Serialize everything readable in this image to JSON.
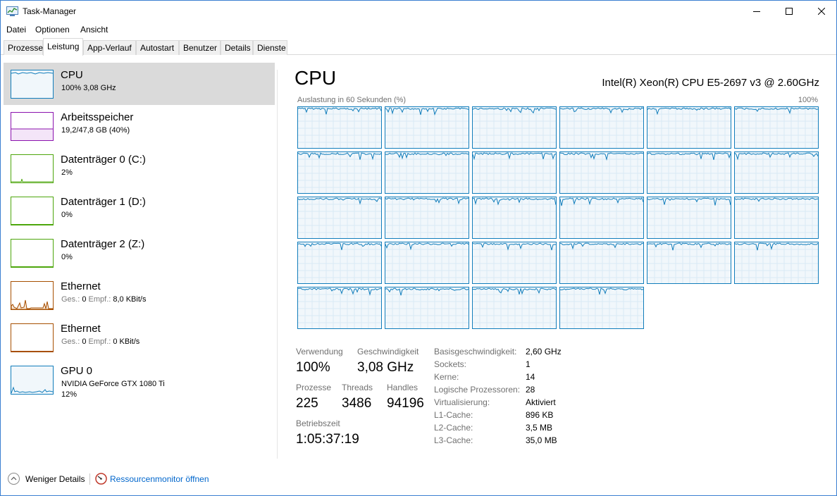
{
  "window": {
    "title": "Task-Manager"
  },
  "menu": [
    "Datei",
    "Optionen",
    "Ansicht"
  ],
  "tabs": [
    "Prozesse",
    "Leistung",
    "App-Verlauf",
    "Autostart",
    "Benutzer",
    "Details",
    "Dienste"
  ],
  "active_tab": "Leistung",
  "sidebar": {
    "items": [
      {
        "title": "CPU",
        "sub1": "100%  3,08 GHz",
        "sub2": "",
        "color": "#117dbb",
        "icon": "cpu-graph-icon"
      },
      {
        "title": "Arbeitsspeicher",
        "sub1": "19,2/47,8 GB (40%)",
        "sub2": "",
        "color": "#8b12ae",
        "icon": "memory-graph-icon"
      },
      {
        "title": "Datenträger 0 (C:)",
        "sub1": "2%",
        "sub2": "",
        "color": "#4da60c",
        "icon": "disk-graph-icon"
      },
      {
        "title": "Datenträger 1 (D:)",
        "sub1": "0%",
        "sub2": "",
        "color": "#4da60c",
        "icon": "disk-graph-icon"
      },
      {
        "title": "Datenträger 2 (Z:)",
        "sub1": "0%",
        "sub2": "",
        "color": "#4da60c",
        "icon": "disk-graph-icon"
      },
      {
        "title": "Ethernet",
        "sub1_label": "Ges.: ",
        "sub1_a": "0",
        "sub1_label2": " Empf.: ",
        "sub1_b": "8,0 KBit/s",
        "color": "#a74f01",
        "icon": "ethernet-graph-icon"
      },
      {
        "title": "Ethernet",
        "sub1_label": "Ges.: ",
        "sub1_a": "0",
        "sub1_label2": " Empf.: ",
        "sub1_b": "0 KBit/s",
        "color": "#a74f01",
        "icon": "ethernet-graph-icon"
      },
      {
        "title": "GPU 0",
        "sub1": "NVIDIA GeForce GTX 1080 Ti",
        "sub2": "12%",
        "color": "#117dbb",
        "icon": "gpu-graph-icon"
      }
    ]
  },
  "main": {
    "title": "CPU",
    "model": "Intel(R) Xeon(R) CPU E5-2697 v3 @ 2.60GHz",
    "graph_label": "Auslastung in 60 Sekunden (%)",
    "graph_max": "100%",
    "logical_processors_shown": 28,
    "accent_color": "#117dbb",
    "stats": {
      "usage_label": "Verwendung",
      "usage": "100%",
      "speed_label": "Geschwindigkeit",
      "speed": "3,08 GHz",
      "processes_label": "Prozesse",
      "processes": "225",
      "threads_label": "Threads",
      "threads": "3486",
      "handles_label": "Handles",
      "handles": "94196",
      "uptime_label": "Betriebszeit",
      "uptime": "1:05:37:19"
    },
    "info": [
      {
        "label": "Basisgeschwindigkeit:",
        "value": "2,60 GHz"
      },
      {
        "label": "Sockets:",
        "value": "1"
      },
      {
        "label": "Kerne:",
        "value": "14"
      },
      {
        "label": "Logische Prozessoren:",
        "value": "28"
      },
      {
        "label": "Virtualisierung:",
        "value": "Aktiviert"
      },
      {
        "label": "L1-Cache:",
        "value": "896 KB"
      },
      {
        "label": "L2-Cache:",
        "value": "3,5 MB"
      },
      {
        "label": "L3-Cache:",
        "value": "35,0 MB"
      }
    ]
  },
  "footer": {
    "less_details": "Weniger Details",
    "resource_monitor": "Ressourcenmonitor öffnen"
  }
}
